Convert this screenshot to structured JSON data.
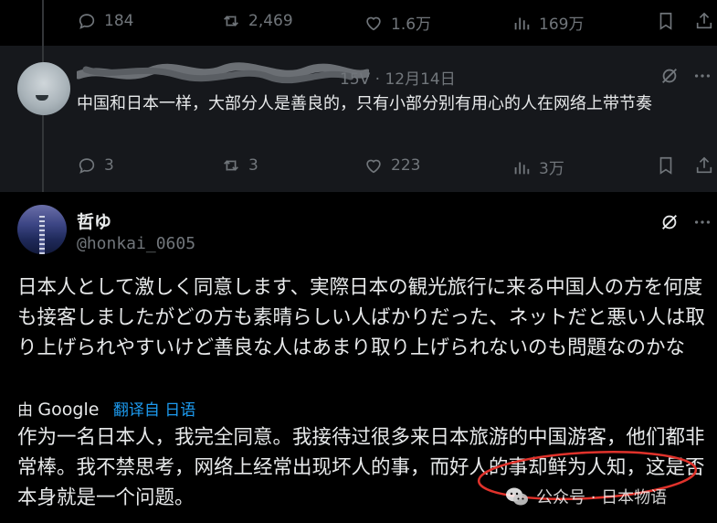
{
  "prev_tweet_actions": {
    "replies": "184",
    "retweets": "2,469",
    "likes": "1.6万",
    "views": "169万"
  },
  "reply_tweet": {
    "meta": "15V · 12月14日",
    "text": "中国和日本一样，大部分人是善良的，只有小部分别有用心的人在网络上带节奏",
    "replies": "3",
    "retweets": "3",
    "likes": "223",
    "views": "3万"
  },
  "main_tweet": {
    "name": "哲ゆ",
    "handle": "@honkai_0605",
    "text_jp": "日本人として激しく同意します、実際日本の観光旅行に来る中国人の方を何度も接客しましたがどの方も素晴らしい人ばかりだった、ネットだと悪い人は取り上げられやすいけど善良な人はあまり取り上げられないのも問題なのかな",
    "translate_prefix": "由",
    "translate_provider": "Google",
    "translate_link": "翻译自 日语",
    "text_cn": "作为一名日本人，我完全同意。我接待过很多来日本旅游的中国游客，他们都非常棒。我不禁思考，网络上经常出现坏人的事，而好人的事却鲜为人知，这是否本身就是一个问题。"
  },
  "watermark": {
    "text": "公众号 · 日本物语"
  },
  "colors": {
    "background": "#000000",
    "reply_background": "#16181c",
    "text": "#e7e9ea",
    "muted": "#71767b",
    "link": "#1d9bf0",
    "annotation": "#e0322b"
  }
}
